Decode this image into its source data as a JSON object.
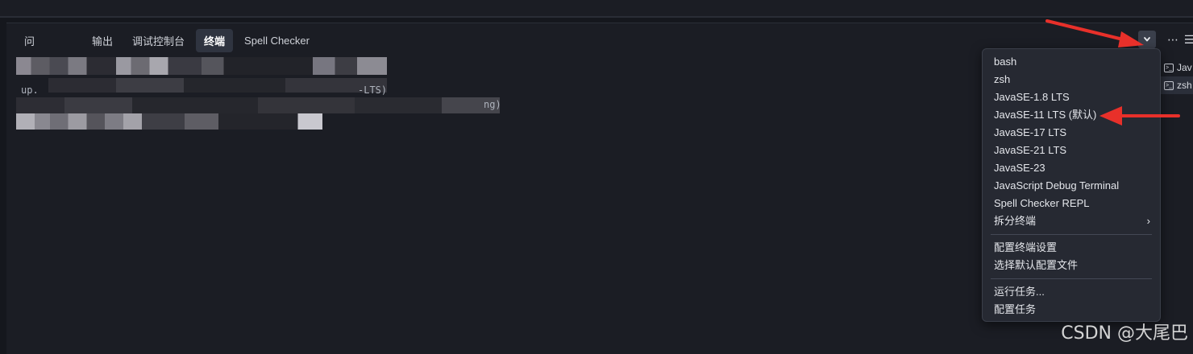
{
  "panel": {
    "tabs": [
      {
        "label": "问",
        "name": "tab-problems"
      },
      {
        "label": "输出",
        "name": "tab-output"
      },
      {
        "label": "调试控制台",
        "name": "tab-debug-console"
      },
      {
        "label": "终端",
        "name": "tab-terminal",
        "active": true
      },
      {
        "label": "Spell Checker",
        "name": "tab-spell-checker"
      }
    ],
    "actions": {
      "new_terminal": "+",
      "more": "⋯",
      "layout": "☰"
    }
  },
  "terminal_output": {
    "line1_fragment": "-LTS)",
    "line2_fragment": "ng)",
    "line0_prefix": "up."
  },
  "terminal_list": [
    {
      "label": "Jav",
      "icon": "terminal-icon"
    },
    {
      "label": "zsh",
      "icon": "terminal-icon",
      "selected": true
    }
  ],
  "dropdown_menu": {
    "groups": [
      [
        "bash",
        "zsh",
        "JavaSE-1.8 LTS",
        "JavaSE-11 LTS (默认)",
        "JavaSE-17 LTS",
        "JavaSE-21 LTS",
        "JavaSE-23",
        "JavaScript Debug Terminal",
        "Spell Checker REPL",
        "拆分终端"
      ],
      [
        "配置终端设置",
        "选择默认配置文件"
      ],
      [
        "运行任务...",
        "配置任务"
      ]
    ]
  },
  "watermark": "CSDN @大尾巴",
  "colors": {
    "background": "#15171d",
    "panel": "#1b1d24",
    "menu": "#262932",
    "annotation_arrow": "#e8302a"
  }
}
